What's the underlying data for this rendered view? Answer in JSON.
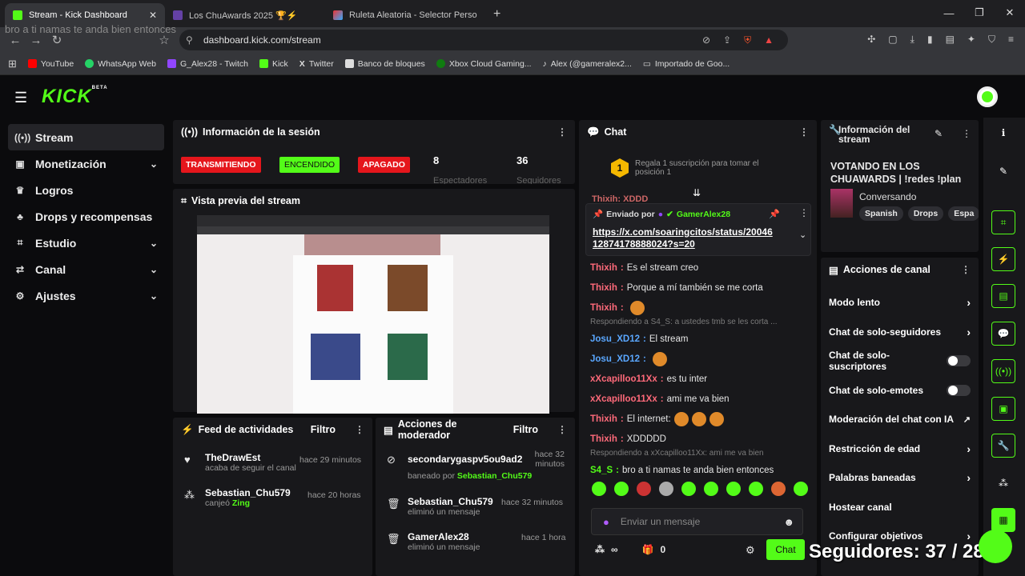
{
  "browser": {
    "tabs": [
      {
        "label": "Stream - Kick Dashboard",
        "color": "#53fc18"
      },
      {
        "label": "Los ChuAwards 2025 🏆⚡",
        "color": "#6441a5"
      },
      {
        "label": "Ruleta Aleatoria - Selector Personaliz",
        "color": "#e33"
      }
    ],
    "new_tab": "+",
    "url": "dashboard.kick.com/stream",
    "overlay_text": "bro a ti namas te anda bien entonces",
    "bookmarks": [
      "YouTube",
      "WhatsApp Web",
      "G_Alex28 - Twitch",
      "Kick",
      "Twitter",
      "Banco de bloques",
      "Xbox Cloud Gaming...",
      "Alex (@gameralex2...",
      "Importado de Goo..."
    ],
    "bookmark_colors": [
      "#f00",
      "#25d366",
      "#9146ff",
      "#53fc18",
      "#fff",
      "#ddd",
      "#107c10",
      "#fff",
      "#ccc"
    ]
  },
  "nav": {
    "logo": "KICK",
    "beta": "BETA"
  },
  "sidebar": {
    "items": [
      {
        "label": "Stream",
        "icon": "((•))"
      },
      {
        "label": "Monetización",
        "icon": "▣"
      },
      {
        "label": "Logros",
        "icon": "🏆"
      },
      {
        "label": "Drops y recompensas",
        "icon": "♣"
      },
      {
        "label": "Estudio",
        "icon": "⌗"
      },
      {
        "label": "Canal",
        "icon": "⇄"
      },
      {
        "label": "Ajustes",
        "icon": "⚙"
      }
    ]
  },
  "session": {
    "title": "Información de la sesión",
    "badges": [
      "TRANSMITIENDO",
      "ENCENDIDO",
      "APAGADO"
    ],
    "viewers": "8",
    "viewers_label": "Espectadores",
    "followers": "36",
    "followers_label": "Seguidores"
  },
  "preview": {
    "title": "Vista previa del stream"
  },
  "feed": {
    "title": "Feed de actividades",
    "filter": "Filtro",
    "items": [
      {
        "name": "TheDrawEst",
        "sub": "acaba de seguir el canal",
        "time": "hace 29 minutos"
      },
      {
        "name": "Sebastian_Chu579",
        "sub_pre": "canjeó ",
        "sub_hl": "Zing",
        "time": "hace 20 horas"
      }
    ]
  },
  "mod": {
    "title": "Acciones de moderador",
    "filter": "Filtro",
    "items": [
      {
        "name": "secondarygaspv5ou9ad2",
        "sub_pre": "baneado por ",
        "sub_hl": "Sebastian_Chu579",
        "time": "hace 32 minutos"
      },
      {
        "name": "Sebastian_Chu579",
        "sub": "eliminó un mensaje",
        "time": "hace 32 minutos"
      },
      {
        "name": "GamerAlex28",
        "sub": "eliminó un mensaje",
        "time": "hace 1 hora"
      }
    ]
  },
  "chat": {
    "title": "Chat",
    "gift_text": "Regala 1 suscripción para tomar el posición 1",
    "gift_rank": "1",
    "pinned_by": "Enviado por",
    "pinned_user": "GamerAlex28",
    "pinned_link": "https://x.com/soaringcitos/status/2004612874178888024?s=20",
    "cut_msg": "Thixih: XDDD",
    "messages": [
      {
        "user": "Thixih",
        "color": "#ff6a7a",
        "text": "Es el stream creo"
      },
      {
        "user": "Thixih",
        "color": "#ff6a7a",
        "text": "Porque a mí también se me corta"
      },
      {
        "user": "Thixih",
        "color": "#ff6a7a",
        "text": "",
        "emotes": 1
      },
      {
        "reply": "Respondiendo a S4_S: a ustedes tmb se les corta ..."
      },
      {
        "user": "Josu_XD12",
        "color": "#5aa7ff",
        "text": "El stream"
      },
      {
        "user": "Josu_XD12",
        "color": "#5aa7ff",
        "text": "",
        "emotes": 1
      },
      {
        "user": "xXcapilloo11Xx",
        "color": "#ff6a7a",
        "text": "es tu inter"
      },
      {
        "user": "xXcapilloo11Xx",
        "color": "#ff6a7a",
        "text": "ami me va bien"
      },
      {
        "user": "Thixih",
        "color": "#ff6a7a",
        "text": "El internet:",
        "emotes": 3
      },
      {
        "user": "Thixih",
        "color": "#ff6a7a",
        "text": "XDDDDD"
      },
      {
        "reply": "Respondiendo a xXcapilloo11Xx: ami me va bien"
      },
      {
        "user": "S4_S",
        "color": "#53fc18",
        "text": "bro a ti namas te anda bien entonces"
      }
    ],
    "input_placeholder": "Enviar un mensaje",
    "points": "∞",
    "gifts": "0",
    "send": "Chat"
  },
  "stream_info": {
    "title": "Información del stream",
    "stream_title": "VOTANDO EN LOS CHUAWARDS | !redes !plan",
    "category": "Conversando",
    "tags": [
      "Spanish",
      "Drops",
      "Espa"
    ]
  },
  "channel_actions": {
    "title": "Acciones de canal",
    "items": [
      {
        "label": "Modo lento",
        "type": "chev"
      },
      {
        "label": "Chat de solo-seguidores",
        "type": "chev"
      },
      {
        "label": "Chat de solo-suscriptores",
        "type": "toggle"
      },
      {
        "label": "Chat de solo-emotes",
        "type": "toggle"
      },
      {
        "label": "Moderación del chat con IA",
        "type": "ext"
      },
      {
        "label": "Restricción de edad",
        "type": "chev"
      },
      {
        "label": "Palabras baneadas",
        "type": "chev"
      },
      {
        "label": "Hostear canal",
        "type": "none"
      },
      {
        "label": "Configurar objetivos",
        "type": "chev"
      }
    ]
  },
  "overlay": {
    "followers_text": "Seguidores: 37 / 28"
  }
}
